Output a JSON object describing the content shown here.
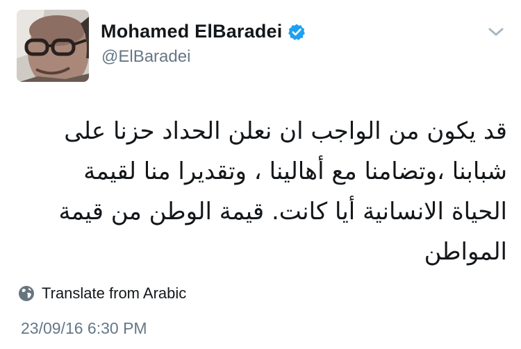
{
  "tweet": {
    "author": {
      "display_name": "Mohamed ElBaradei",
      "handle": "@ElBaradei",
      "verified": true,
      "avatar_icon": "profile-photo"
    },
    "menu_icon": "chevron-down-icon",
    "text": "قد يكون من الواجب ان نعلن الحداد حزنا على شبابنا ،وتضامنا مع أهالينا ، وتقديرا منا لقيمة الحياة الانسانية أيا كانت. قيمة الوطن من قيمة المواطن",
    "translate": {
      "icon": "globe-icon",
      "label": "Translate from Arabic"
    },
    "timestamp": "23/09/16 6:30 PM"
  },
  "colors": {
    "primary_text": "#14171a",
    "secondary_text": "#657786",
    "verified_badge": "#1da1f2",
    "background": "#ffffff"
  }
}
